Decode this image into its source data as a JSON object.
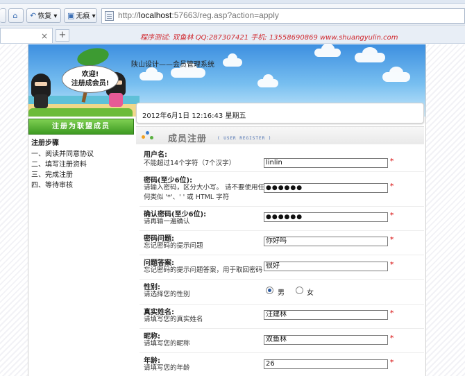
{
  "browser": {
    "toolbar": {
      "back_label": "恢复",
      "trace_label": "无痕",
      "url_prefix": "http://",
      "url_host": "localhost",
      "url_rest": ":57663/reg.asp?action=apply"
    },
    "promo_text": "程序测试: 双鱼林  QQ:287307421  手机: 13558690869 www.shuangyulin.com"
  },
  "banner": {
    "title": "陕山设计——会员管理系统",
    "bubble_line1": "欢迎!",
    "bubble_line2": "注册成会员!"
  },
  "datetime": "2012年6月1日  12:16:43 星期五",
  "sidebar": {
    "header": "注册为联盟成员",
    "steps_title": "注册步骤",
    "steps": [
      "一、阅读并同意协议",
      "二、填写注册资料",
      "三、完成注册",
      "四、等待审核"
    ]
  },
  "form": {
    "title": "成员注册",
    "title_en": "( USER REGISTER )",
    "required_mark": "*",
    "fields": {
      "username": {
        "label": "用户名:",
        "hint": "不能超过14个字符（7个汉字）",
        "value": "linlin"
      },
      "password": {
        "label": "密码(至少6位):",
        "hint": "请输入密码，区分大小写。 请不要使用任何类似 '*'、' ' 或 HTML 字符",
        "value": "●●●●●●"
      },
      "confirm": {
        "label": "确认密码(至少6位):",
        "hint": "请再输一遍确认",
        "value": "●●●●●●"
      },
      "question": {
        "label": "密码问题:",
        "hint": "忘记密码的提示问题",
        "value": "你好吗"
      },
      "answer": {
        "label": "问题答案:",
        "hint": "忘记密码的提示问题答案，用于取回密码",
        "value": "很好"
      },
      "gender": {
        "label": "性别:",
        "hint": "请选择您的性别",
        "male": "男",
        "female": "女",
        "selected": "男"
      },
      "realname": {
        "label": "真实姓名:",
        "hint": "请填写您的真实姓名",
        "value": "汪建林"
      },
      "nickname": {
        "label": "昵称:",
        "hint": "请填写您的昵称",
        "value": "双鱼林"
      },
      "age": {
        "label": "年龄:",
        "hint": "请填写您的年龄",
        "value": "26"
      }
    }
  },
  "colors": {
    "required": "#e03c3c",
    "promo": "#d0292f",
    "sidebar_header": "#3d9a22"
  }
}
